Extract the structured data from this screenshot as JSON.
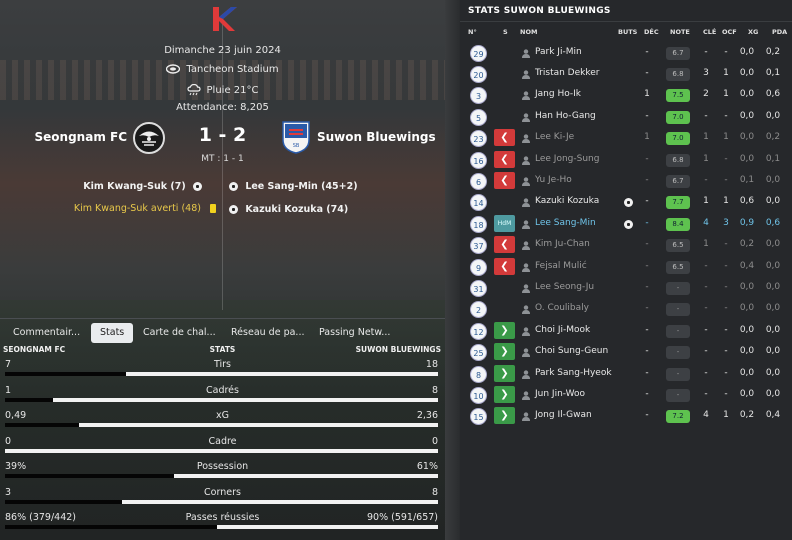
{
  "match": {
    "date": "Dimanche 23 juin 2024",
    "stadium": "Tancheon Stadium",
    "weather": "Pluie 21°C",
    "attendance": "Attendance:  8,205",
    "home_team": "Seongnam FC",
    "away_team": "Suwon Bluewings",
    "score": "1 - 2",
    "halftime": "MT : 1 - 1",
    "home_events": [
      {
        "text": "Kim Kwang-Suk (7)",
        "type": "goal"
      },
      {
        "text": "Kim Kwang-Suk averti (48)",
        "type": "yellow"
      }
    ],
    "away_events": [
      {
        "text": "Lee Sang-Min (45+2)",
        "type": "goal"
      },
      {
        "text": "Kazuki Kozuka (74)",
        "type": "goal"
      }
    ]
  },
  "tabs": [
    "Commentair...",
    "Stats",
    "Carte de chal...",
    "Réseau de pa...",
    "Passing Netw..."
  ],
  "active_tab": "Stats",
  "stats": {
    "home_label": "SEONGNAM FC",
    "center_label": "STATS",
    "away_label": "SUWON BLUEWINGS",
    "rows": [
      {
        "name": "Tirs",
        "home": "7",
        "away": "18",
        "home_share": 0.28
      },
      {
        "name": "Cadrés",
        "home": "1",
        "away": "8",
        "home_share": 0.11
      },
      {
        "name": "xG",
        "home": "0,49",
        "away": "2,36",
        "home_share": 0.17
      },
      {
        "name": "Cadre",
        "home": "0",
        "away": "0",
        "home_share": 0.0
      },
      {
        "name": "Possession",
        "home": "39%",
        "away": "61%",
        "home_share": 0.39
      },
      {
        "name": "Corners",
        "home": "3",
        "away": "8",
        "home_share": 0.27
      },
      {
        "name": "Passes réussies",
        "home": "86% (379/442)",
        "away": "90% (591/657)",
        "home_share": 0.49
      }
    ]
  },
  "right": {
    "title": "STATS SUWON BLUEWINGS",
    "headers": {
      "num": "N°",
      "s": "S",
      "name": "NOM",
      "goals": "BUTS",
      "dec": "DÉC",
      "note": "NOTE",
      "key": "CLÉ",
      "ocf": "OCF",
      "xg": "XG",
      "pda": "PDA"
    },
    "players": [
      {
        "num": "29",
        "sub": "",
        "name": "Park Ji-Min",
        "goal": false,
        "dec": "-",
        "note": "6.7",
        "key": "-",
        "ocf": "-",
        "xg": "0,0",
        "pda": "0,2",
        "style": ""
      },
      {
        "num": "20",
        "sub": "",
        "name": "Tristan Dekker",
        "goal": false,
        "dec": "-",
        "note": "6.8",
        "key": "3",
        "ocf": "1",
        "xg": "0,0",
        "pda": "0,1",
        "style": ""
      },
      {
        "num": "3",
        "sub": "",
        "name": "Jang Ho-Ik",
        "goal": false,
        "dec": "1",
        "note": "7.5",
        "key": "2",
        "ocf": "1",
        "xg": "0,0",
        "pda": "0,6",
        "style": ""
      },
      {
        "num": "5",
        "sub": "",
        "name": "Han Ho-Gang",
        "goal": false,
        "dec": "-",
        "note": "7.0",
        "key": "-",
        "ocf": "-",
        "xg": "0,0",
        "pda": "0,0",
        "style": ""
      },
      {
        "num": "23",
        "sub": "out",
        "name": "Lee Ki-Je",
        "goal": false,
        "dec": "1",
        "note": "7.0",
        "key": "1",
        "ocf": "1",
        "xg": "0,0",
        "pda": "0,2",
        "style": "dim"
      },
      {
        "num": "16",
        "sub": "out",
        "name": "Lee Jong-Sung",
        "goal": false,
        "dec": "-",
        "note": "6.8",
        "key": "1",
        "ocf": "-",
        "xg": "0,0",
        "pda": "0,1",
        "style": "dim"
      },
      {
        "num": "6",
        "sub": "out",
        "name": "Yu Je-Ho",
        "goal": false,
        "dec": "-",
        "note": "6.7",
        "key": "-",
        "ocf": "-",
        "xg": "0,1",
        "pda": "0,0",
        "style": "dim"
      },
      {
        "num": "14",
        "sub": "",
        "name": "Kazuki Kozuka",
        "goal": true,
        "dec": "-",
        "note": "7.7",
        "key": "1",
        "ocf": "1",
        "xg": "0,6",
        "pda": "0,0",
        "style": ""
      },
      {
        "num": "18",
        "sub": "hdm",
        "sub_label": "HdM",
        "name": "Lee Sang-Min",
        "goal": true,
        "dec": "-",
        "note": "8.4",
        "key": "4",
        "ocf": "3",
        "xg": "0,9",
        "pda": "0,6",
        "style": "hl"
      },
      {
        "num": "37",
        "sub": "out",
        "name": "Kim Ju-Chan",
        "goal": false,
        "dec": "-",
        "note": "6.5",
        "key": "1",
        "ocf": "-",
        "xg": "0,2",
        "pda": "0,0",
        "style": "dim"
      },
      {
        "num": "9",
        "sub": "out",
        "name": "Fejsal Mulić",
        "goal": false,
        "dec": "-",
        "note": "6.5",
        "key": "-",
        "ocf": "-",
        "xg": "0,4",
        "pda": "0,0",
        "style": "dim"
      },
      {
        "num": "31",
        "sub": "",
        "name": "Lee Seong-Ju",
        "goal": false,
        "dec": "-",
        "note": "-",
        "key": "-",
        "ocf": "-",
        "xg": "0,0",
        "pda": "0,0",
        "style": "dim"
      },
      {
        "num": "2",
        "sub": "",
        "name": "O. Coulibaly",
        "goal": false,
        "dec": "-",
        "note": "-",
        "key": "-",
        "ocf": "-",
        "xg": "0,0",
        "pda": "0,0",
        "style": "dim"
      },
      {
        "num": "12",
        "sub": "in",
        "name": "Choi Ji-Mook",
        "goal": false,
        "dec": "-",
        "note": "-",
        "key": "-",
        "ocf": "-",
        "xg": "0,0",
        "pda": "0,0",
        "style": ""
      },
      {
        "num": "25",
        "sub": "in",
        "name": "Choi Sung-Geun",
        "goal": false,
        "dec": "-",
        "note": "-",
        "key": "-",
        "ocf": "-",
        "xg": "0,0",
        "pda": "0,0",
        "style": ""
      },
      {
        "num": "8",
        "sub": "in",
        "name": "Park Sang-Hyeok",
        "goal": false,
        "dec": "-",
        "note": "-",
        "key": "-",
        "ocf": "-",
        "xg": "0,0",
        "pda": "0,0",
        "style": ""
      },
      {
        "num": "10",
        "sub": "in",
        "name": "Jun Jin-Woo",
        "goal": false,
        "dec": "-",
        "note": "-",
        "key": "-",
        "ocf": "-",
        "xg": "0,0",
        "pda": "0,0",
        "style": ""
      },
      {
        "num": "15",
        "sub": "in",
        "name": "Jong Il-Gwan",
        "goal": false,
        "dec": "-",
        "note": "7.2",
        "key": "4",
        "ocf": "1",
        "xg": "0,2",
        "pda": "0,4",
        "style": ""
      }
    ]
  },
  "colors": {
    "rating_good": "#5ec24f",
    "sub_out": "#d33a3a",
    "sub_in": "#3a9a48",
    "highlight": "#6fc3e8",
    "yellow_card": "#f2d21e"
  }
}
